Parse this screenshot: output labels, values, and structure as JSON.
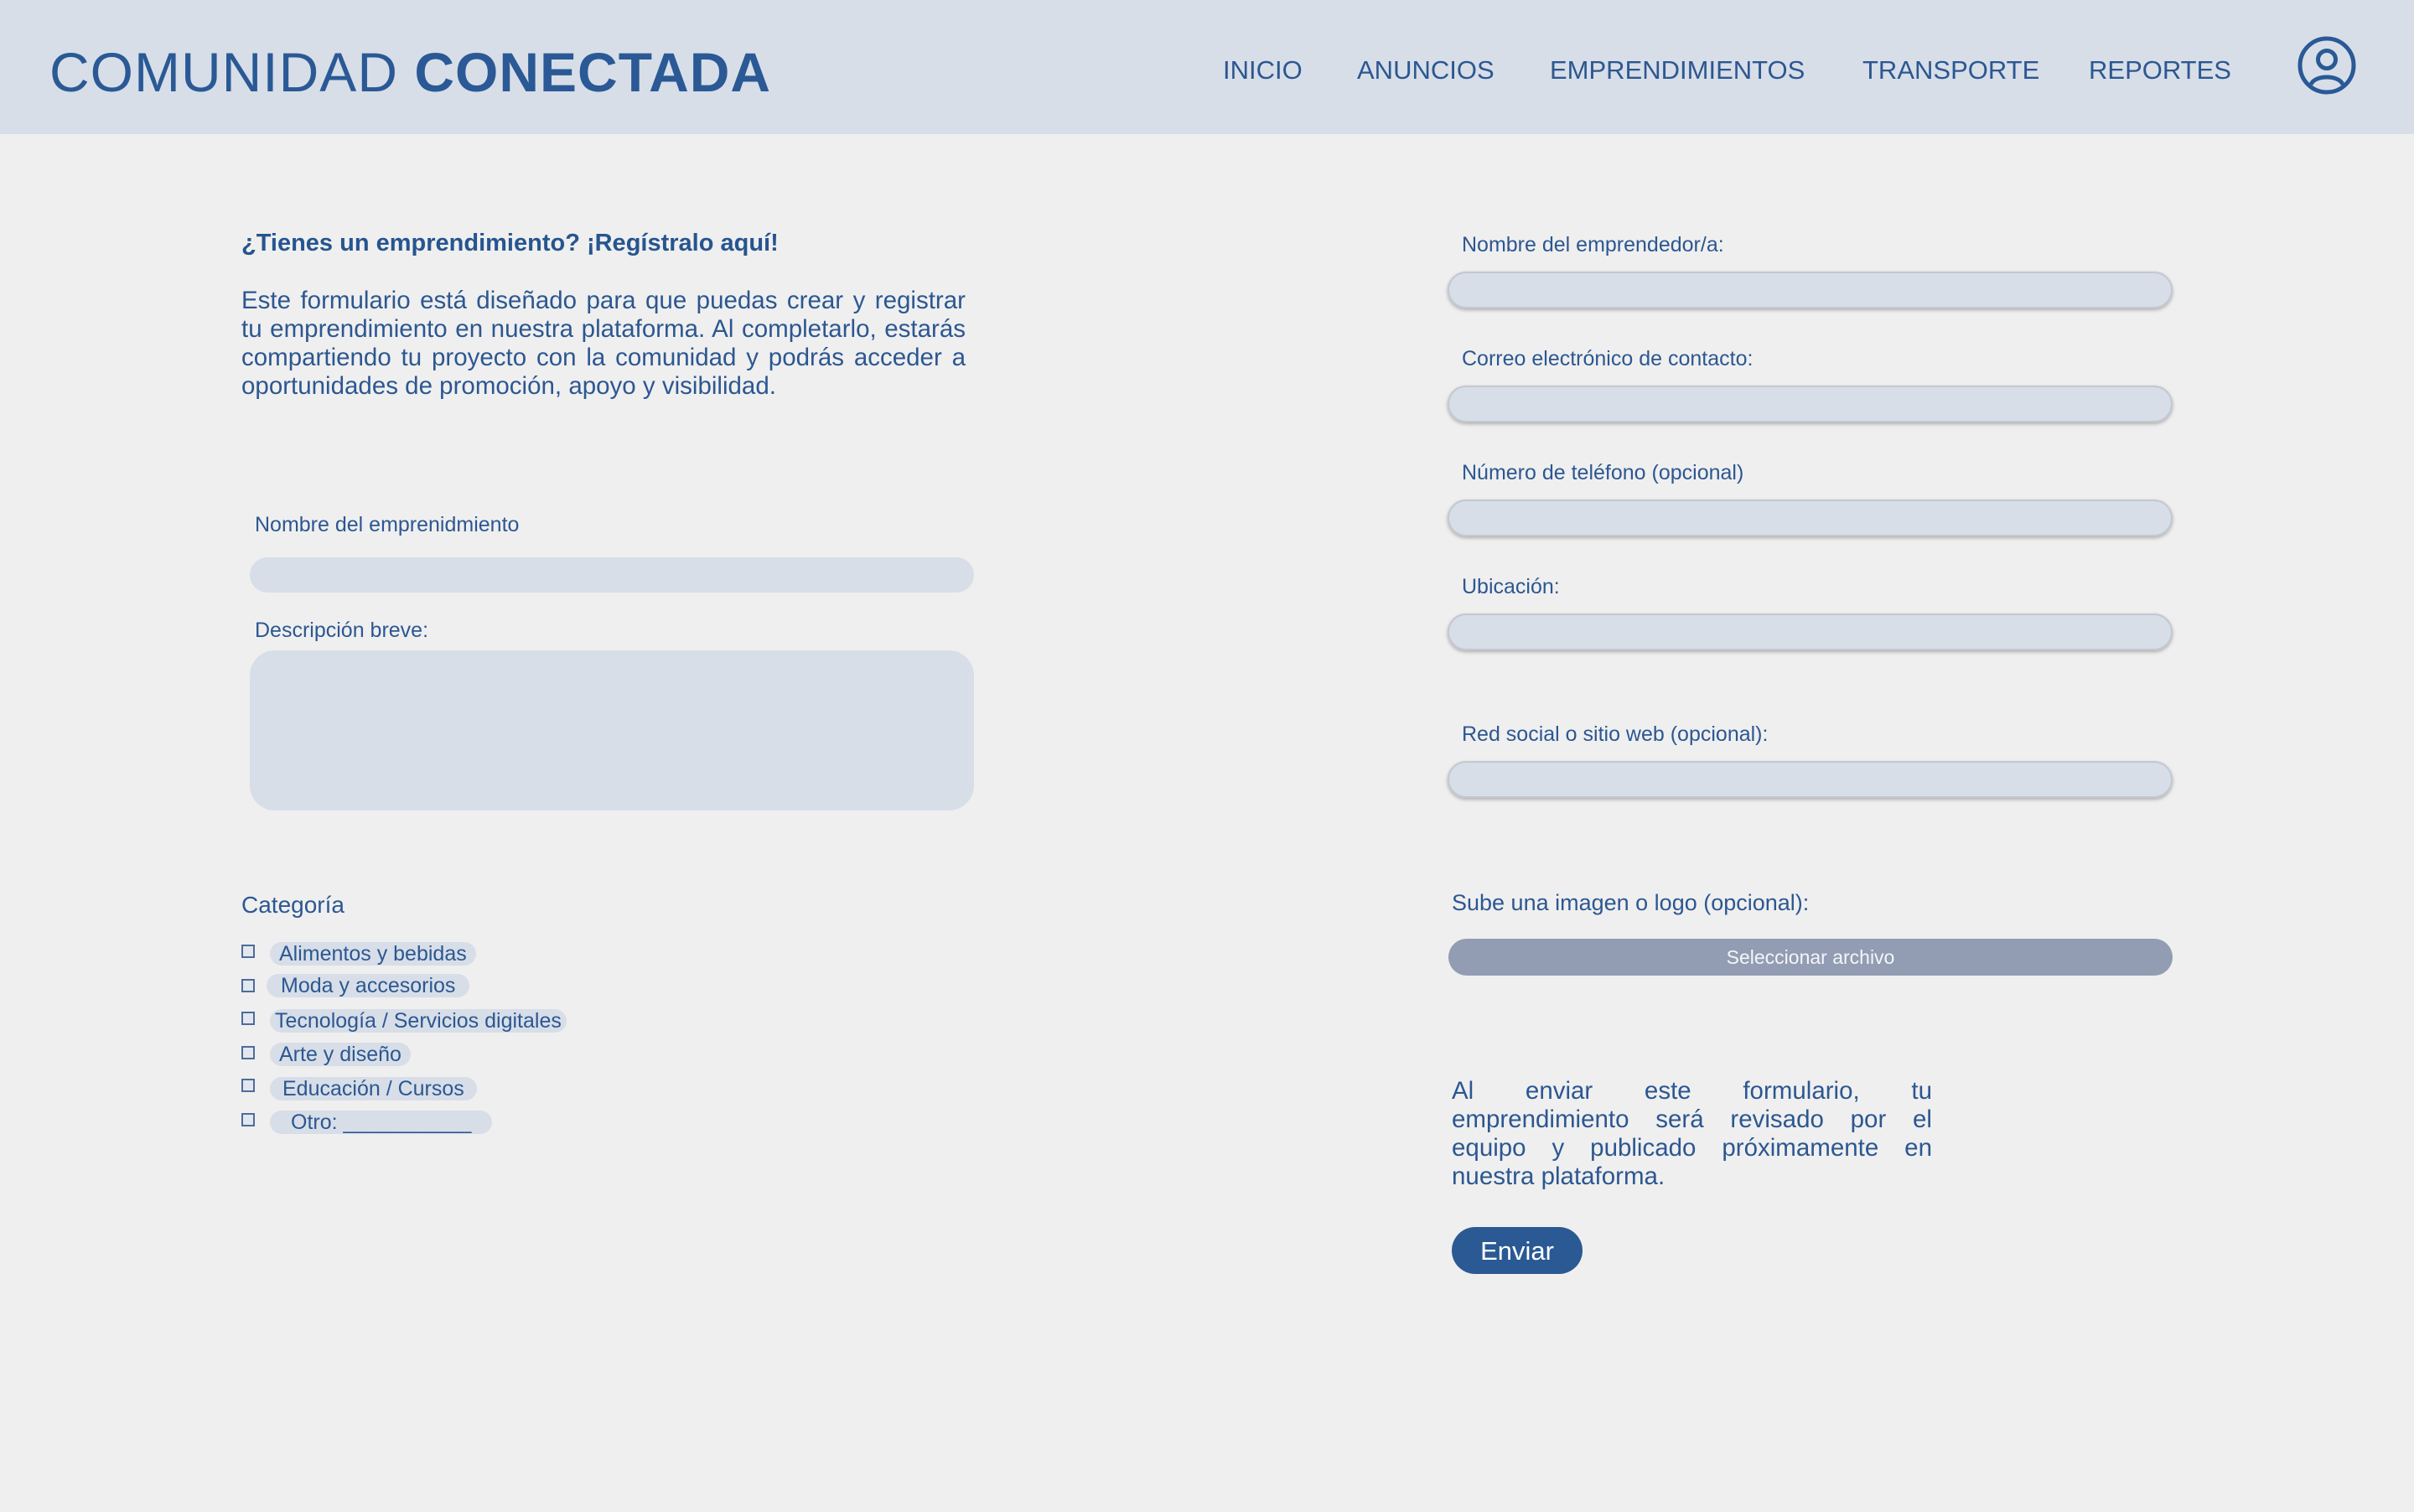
{
  "brand": {
    "part1": "COMUNIDAD",
    "part2": "CONECTADA"
  },
  "nav": {
    "items": [
      {
        "label": "INICIO"
      },
      {
        "label": "ANUNCIOS"
      },
      {
        "label": "EMPRENDIMIENTOS"
      },
      {
        "label": "TRANSPORTE"
      },
      {
        "label": "REPORTES"
      }
    ],
    "user_icon": "user-circle-icon"
  },
  "form_left": {
    "title": "¿Tienes un emprendimiento? ¡Regístralo aquí!",
    "intro": "Este formulario está diseñado para que puedas crear y registrar tu emprendimiento en nuestra plataforma. Al completarlo, estarás compartiendo tu proyecto con la comunidad y podrás acceder a oportunidades de promoción, apoyo y visibilidad.",
    "name_label": "Nombre del emprenidmiento",
    "name_value": "",
    "description_label": "Descripción breve:",
    "description_value": "",
    "category_heading": "Categoría",
    "categories": [
      {
        "label": "Alimentos y bebidas",
        "checked": false
      },
      {
        "label": "Moda y accesorios",
        "checked": false
      },
      {
        "label": "Tecnología / Servicios digitales",
        "checked": false
      },
      {
        "label": "Arte y diseño",
        "checked": false
      },
      {
        "label": "Educación / Cursos",
        "checked": false
      },
      {
        "label": "Otro: ___________",
        "checked": false
      }
    ]
  },
  "form_right": {
    "owner_label": "Nombre del emprendedor/a:",
    "email_label": "Correo electrónico de contacto:",
    "phone_label": "Número de teléfono (opcional)",
    "location_label": "Ubicación:",
    "social_label": "Red social o sitio web (opcional):",
    "upload_label": "Sube una imagen o logo (opcional):",
    "upload_button": "Seleccionar archivo",
    "note": "Al enviar este formulario, tu emprendimiento será revisado por el equipo y publicado próximamente en nuestra plataforma.",
    "submit": "Enviar"
  },
  "colors": {
    "accent": "#2a5995",
    "header_bg": "#d7dee8",
    "page_bg": "#efefef",
    "field_bg": "#d7dee8",
    "file_button_bg": "#929db3"
  }
}
